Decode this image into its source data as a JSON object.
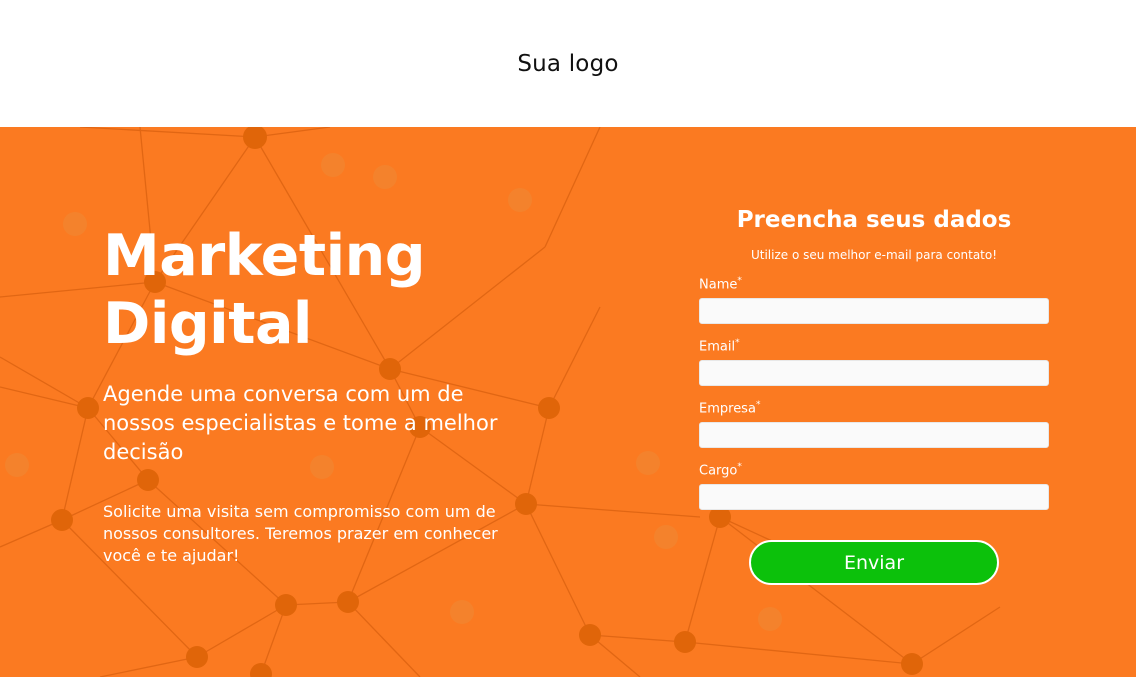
{
  "header": {
    "logo_text": "Sua logo"
  },
  "hero": {
    "title_line1": "Marketing",
    "title_line2": "Digital",
    "subtitle": "Agende uma conversa com um de nossos especialistas e tome a melhor decisão",
    "description": "Solicite uma visita sem compromisso com um de nossos consultores. Teremos prazer em conhecer você e te ajudar!"
  },
  "form": {
    "title": "Preencha seus dados",
    "note": "Utilize o seu melhor e-mail para contato!",
    "fields": [
      {
        "label": "Name",
        "required_mark": "*",
        "value": ""
      },
      {
        "label": "Email",
        "required_mark": "*",
        "value": ""
      },
      {
        "label": "Empresa",
        "required_mark": "*",
        "value": ""
      },
      {
        "label": "Cargo",
        "required_mark": "*",
        "value": ""
      }
    ],
    "submit_label": "Enviar"
  },
  "colors": {
    "hero_background": "#fb7a21",
    "submit_button": "#0cc10b",
    "network_lines": "#d65a0a"
  }
}
